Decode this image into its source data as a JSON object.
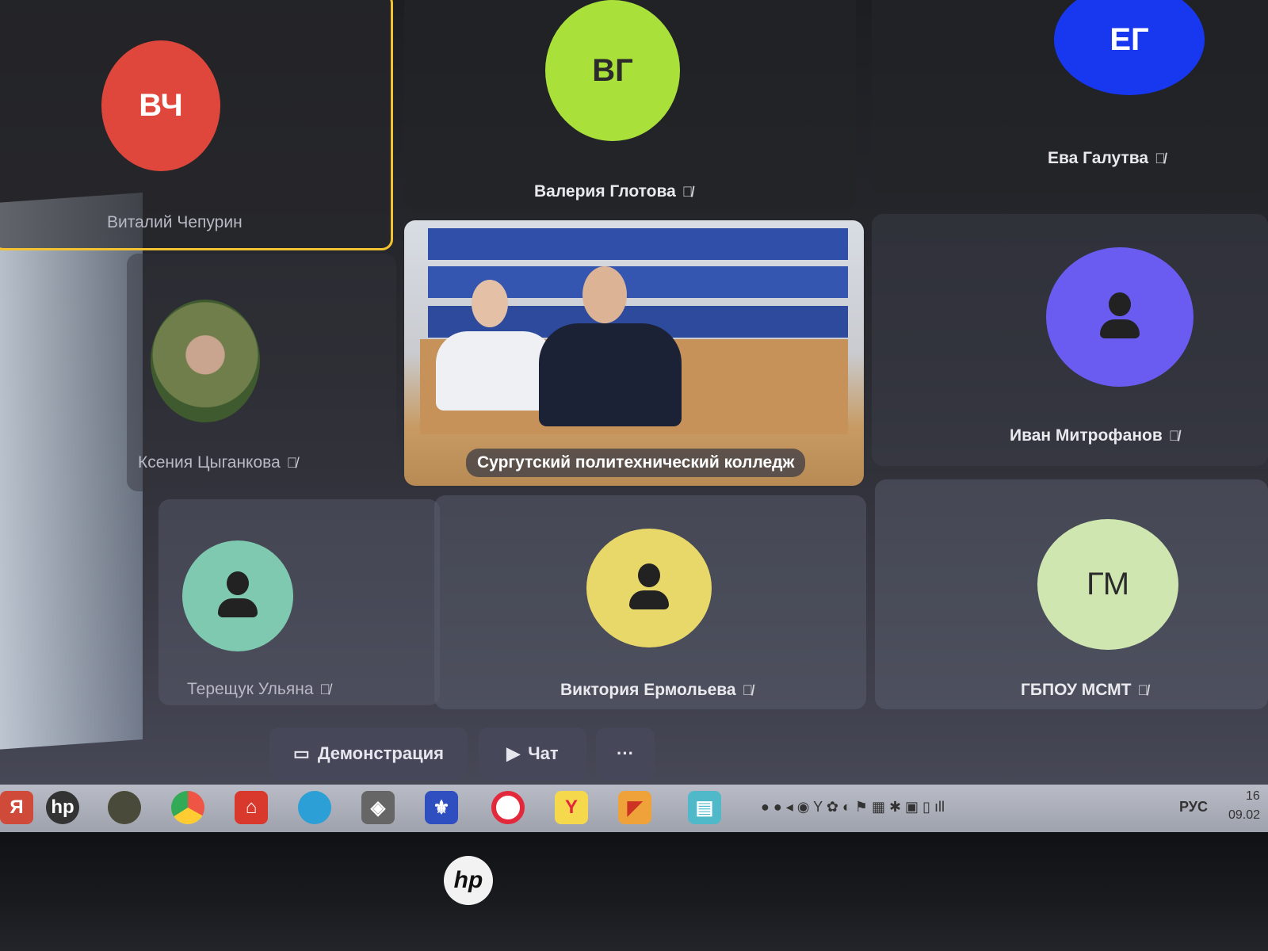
{
  "participants": [
    {
      "initials": "ВЧ",
      "name": "Виталий Чепурин",
      "avatar_color": "#e0473c"
    },
    {
      "initials": "ВГ",
      "name": "Валерия Глотова",
      "avatar_color": "#a9e03a"
    },
    {
      "initials": "ЕГ",
      "name": "Ева Галутва",
      "avatar_color": "#1838f0"
    },
    {
      "name": "Ксения Цыганкова"
    },
    {
      "name": "Иван Митрофанов",
      "avatar_color": "#6a5cf0"
    },
    {
      "name": "Терещук Ульяна",
      "avatar_color": "#7fc9b0"
    },
    {
      "name": "Виктория Ермольева",
      "avatar_color": "#e8d86a"
    },
    {
      "initials": "ГМ",
      "name": "ГБПОУ МСМТ",
      "avatar_color": "#cfe6b0"
    }
  ],
  "video_caption": "Сургутский политехнический колледж",
  "controls": {
    "demo_label": "Демонстрация",
    "chat_label": "Чат",
    "more_label": "···"
  },
  "taskbar": {
    "language": "РУС",
    "time": "16",
    "date": "09.02"
  },
  "icons": [
    "yandex-icon",
    "hp-icon",
    "camera-icon",
    "chrome-icon",
    "acrobat-icon",
    "edge-icon",
    "shield-icon",
    "university-icon",
    "opera-icon",
    "yandex-browser-icon",
    "paint-icon",
    "store-icon"
  ]
}
